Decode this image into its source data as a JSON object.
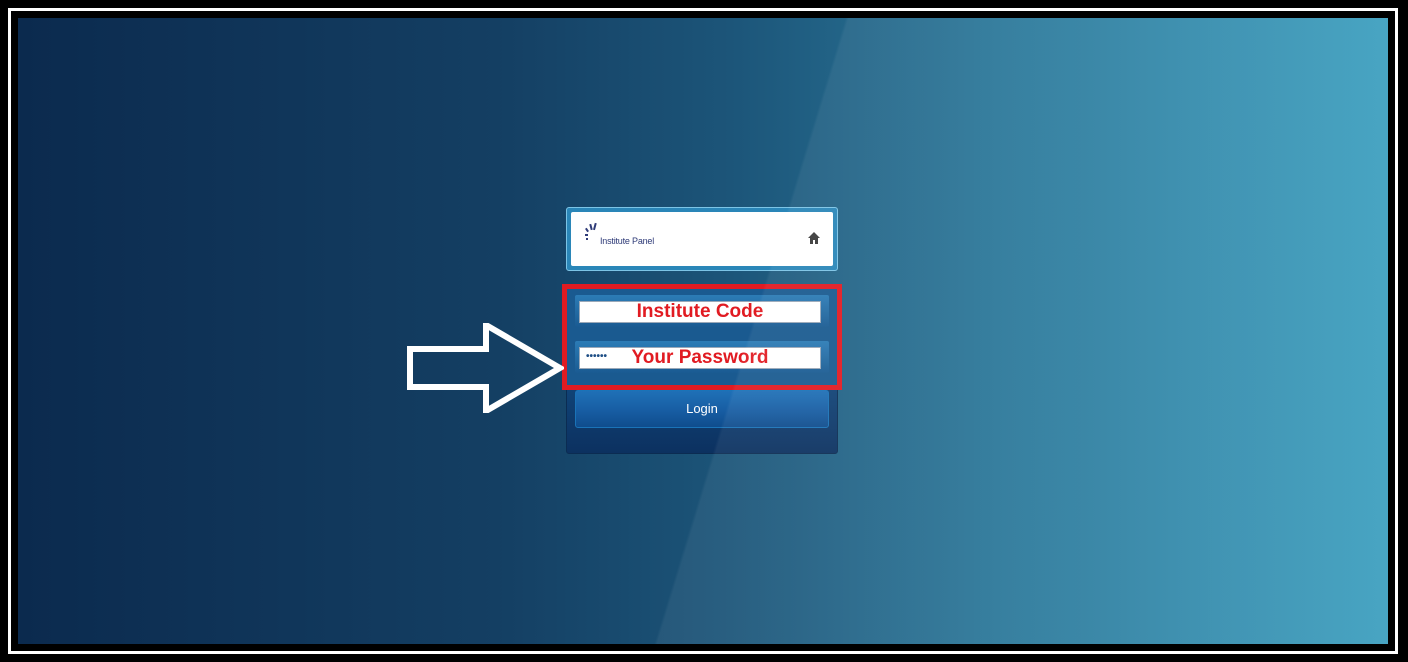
{
  "header": {
    "logo_text": "Institute Panel",
    "home_icon": "home-icon"
  },
  "form": {
    "institute_code_label": "Institute Code",
    "password_mask": "••••••",
    "password_label": "Your Password",
    "login_label": "Login"
  },
  "annotation": {
    "highlight_color": "#e11b22",
    "arrow_icon": "arrow-right-outline-icon"
  },
  "colors": {
    "background_start": "#0b2a4e",
    "background_end": "#3d9fbf",
    "panel_blue": "#185fa5"
  }
}
